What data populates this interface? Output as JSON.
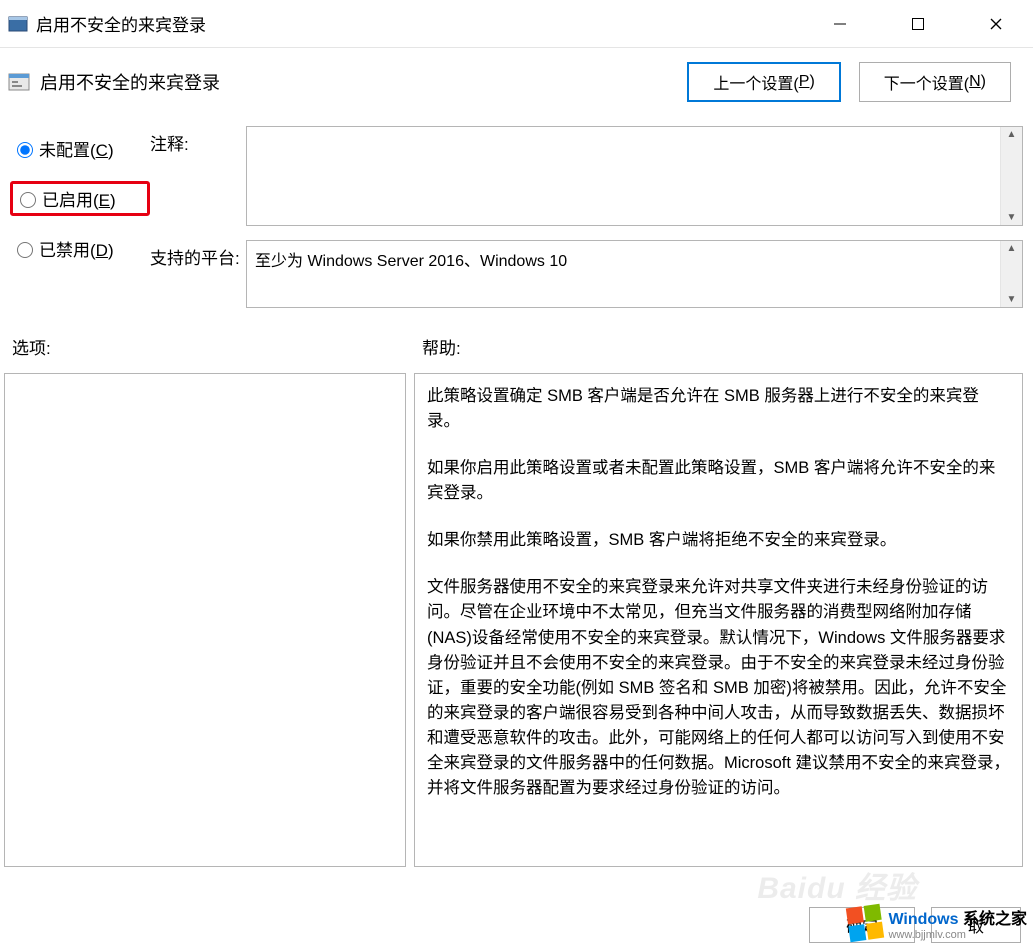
{
  "window": {
    "title": "启用不安全的来宾登录"
  },
  "header": {
    "policy_title": "启用不安全的来宾登录",
    "prev_button": "上一个设置(P)",
    "next_button": "下一个设置(N)"
  },
  "radios": {
    "not_configured": "未配置(C)",
    "enabled": "已启用(E)",
    "disabled": "已禁用(D)",
    "selected": "not_configured"
  },
  "labels": {
    "comment": "注释:",
    "supported": "支持的平台:",
    "options": "选项:",
    "help": "帮助:"
  },
  "fields": {
    "comment": "",
    "supported": "至少为 Windows Server 2016、Windows 10"
  },
  "help": {
    "p1": "此策略设置确定 SMB 客户端是否允许在 SMB 服务器上进行不安全的来宾登录。",
    "p2": "如果你启用此策略设置或者未配置此策略设置，SMB 客户端将允许不安全的来宾登录。",
    "p3": "如果你禁用此策略设置，SMB 客户端将拒绝不安全的来宾登录。",
    "p4": "文件服务器使用不安全的来宾登录来允许对共享文件夹进行未经身份验证的访问。尽管在企业环境中不太常见，但充当文件服务器的消费型网络附加存储(NAS)设备经常使用不安全的来宾登录。默认情况下，Windows 文件服务器要求身份验证并且不会使用不安全的来宾登录。由于不安全的来宾登录未经过身份验证，重要的安全功能(例如 SMB 签名和 SMB 加密)将被禁用。因此，允许不安全的来宾登录的客户端很容易受到各种中间人攻击，从而导致数据丢失、数据损坏和遭受恶意软件的攻击。此外，可能网络上的任何人都可以访问写入到使用不安全来宾登录的文件服务器中的任何数据。Microsoft 建议禁用不安全的来宾登录，并将文件服务器配置为要求经过身份验证的访问。"
  },
  "footer": {
    "ok": "确定",
    "cancel": "取消"
  },
  "watermark": {
    "baidu": "Baidu 经验",
    "brand_main_a": "Windows",
    "brand_main_b": "系统之家",
    "brand_sub": "www.bjjmlv.com"
  }
}
